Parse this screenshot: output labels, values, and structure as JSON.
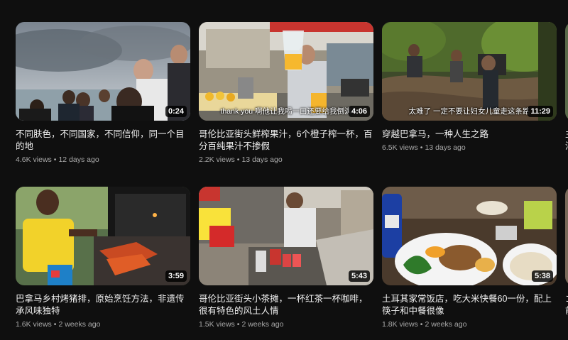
{
  "videos": [
    {
      "title": "不同肤色，不同国家，不同信仰，同一个目的地",
      "views": "4.6K views",
      "age": "12 days ago",
      "duration": "0:24",
      "subtitle": ""
    },
    {
      "title": "哥伦比亚街头鲜榨果汁，6个橙子榨一杯，百分百纯果汁不掺假",
      "views": "2.2K views",
      "age": "13 days ago",
      "duration": "4:06",
      "subtitle": "thank you 啊他让我喝一口还要给我倒满"
    },
    {
      "title": "穿越巴拿马，一种人生之路",
      "views": "6.5K views",
      "age": "13 days ago",
      "duration": "11:29",
      "subtitle": "太难了 一定不要让妇女儿童走这条路"
    },
    {
      "title": "巴拿马乡村烤猪排，原始烹饪方法，非遗传承风味独特",
      "views": "1.6K views",
      "age": "2 weeks ago",
      "duration": "3:59",
      "subtitle": ""
    },
    {
      "title": "哥伦比亚街头小茶摊，一杯红茶一杯咖啡，很有特色的风土人情",
      "views": "1.5K views",
      "age": "2 weeks ago",
      "duration": "5:43",
      "subtitle": ""
    },
    {
      "title": "土耳其家常饭店，吃大米快餐60一份，配上筷子和中餐很像",
      "views": "1.8K views",
      "age": "2 weeks ago",
      "duration": "5:38",
      "subtitle": ""
    }
  ],
  "peek": {
    "row1_title": "主\n湛",
    "row2_title": "ゴ\n前"
  }
}
